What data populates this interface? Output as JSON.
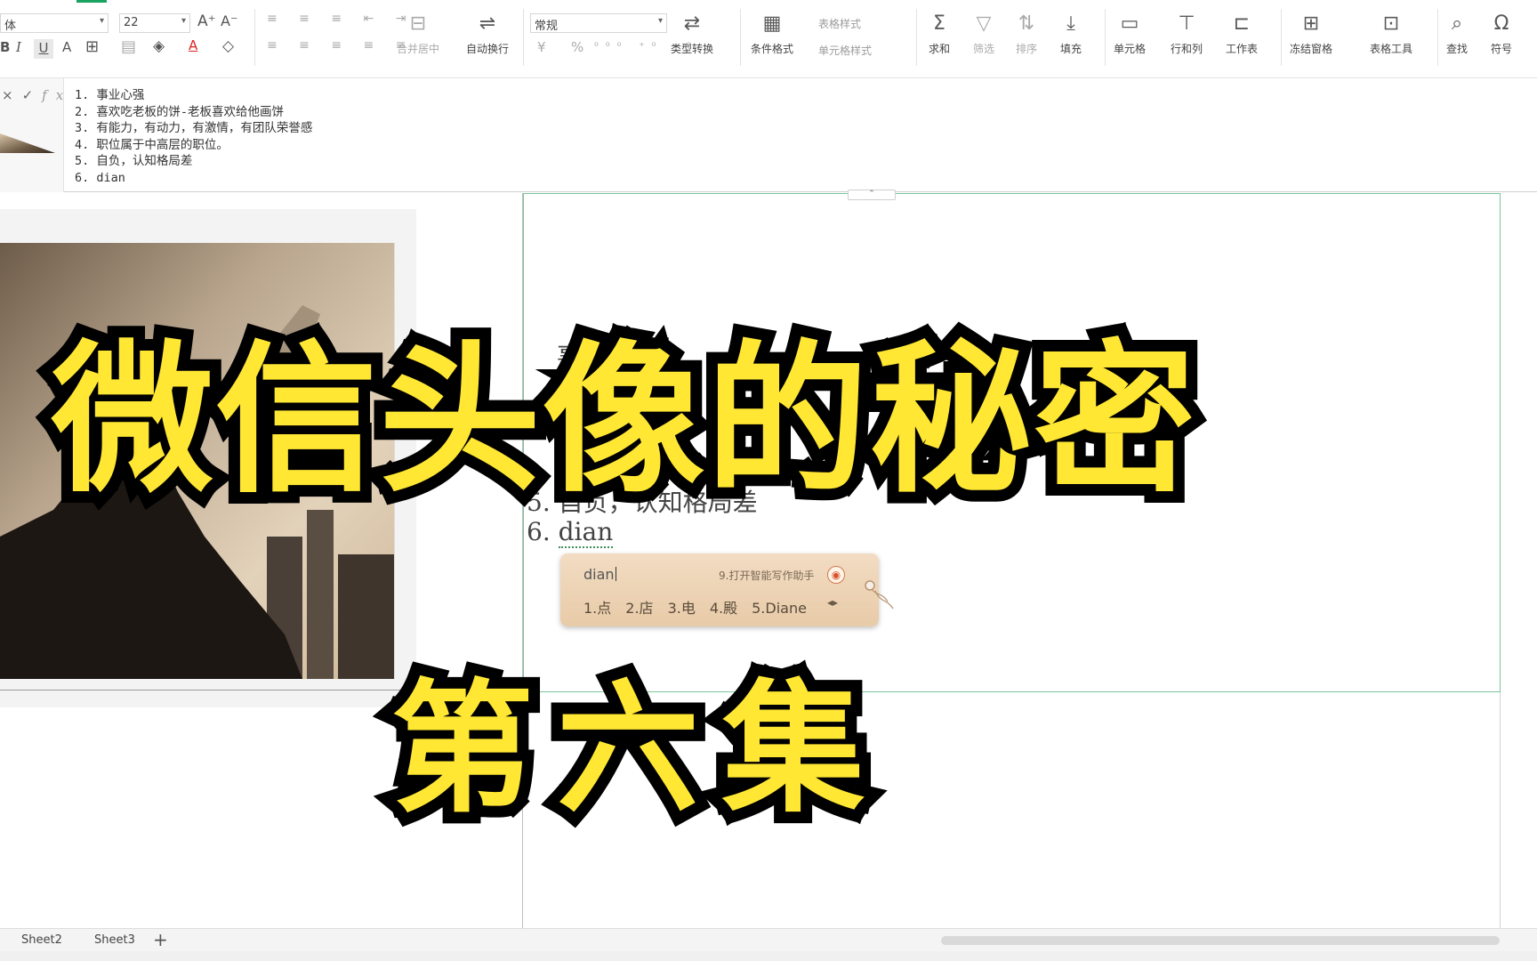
{
  "ribbon": {
    "font_name": "体",
    "font_size": "22",
    "font_buttons": [
      "A⁺",
      "A⁻"
    ],
    "format_buttons": [
      "B",
      "I",
      "U",
      "A"
    ],
    "number_format": "常规",
    "groups": {
      "merge_center": "合并居中",
      "wrap_text": "自动换行",
      "type_convert": "类型转换",
      "conditional_format": "条件格式",
      "table_style": "表格样式",
      "cell_style": "单元格样式",
      "sum": "求和",
      "filter": "筛选",
      "sort": "排序",
      "fill": "填充",
      "cell": "单元格",
      "row_col": "行和列",
      "worksheet": "工作表",
      "freeze": "冻结窗格",
      "table_tools": "表格工具",
      "find": "查找",
      "symbol": "符号"
    },
    "currency_symbol": "¥",
    "percent_symbol": "%"
  },
  "formula_bar": {
    "fx": "fx",
    "lines": [
      "1. 事业心强",
      "2. 喜欢吃老板的饼-老板喜欢给他画饼",
      "3. 有能力，有动力，有激情，有团队荣誉感",
      "4. 职位属于中高层的职位。",
      "5. 自负，认知格局差",
      "6. dian"
    ]
  },
  "sheet": {
    "cell_lines": [
      "事业",
      "喜",
      "能",
      "位",
      "5. 自负，认知格局差"
    ],
    "last_line_prefix": "6. ",
    "last_line_typed": "dian"
  },
  "ime": {
    "typed": "dian",
    "hint": "9.打开智能写作助手",
    "candidates": [
      "1.点",
      "2.店",
      "3.电",
      "4.殿",
      "5.Diane"
    ]
  },
  "overlay": {
    "title": "微信头像的秘密",
    "subtitle": "第六集"
  },
  "sheet_tabs": [
    "Sheet2",
    "Sheet3"
  ],
  "colors": {
    "overlay_fill": "#ffe733",
    "overlay_stroke": "#000000",
    "selection_border": "#7ac59b",
    "ribbon_accent": "#1aa260"
  }
}
